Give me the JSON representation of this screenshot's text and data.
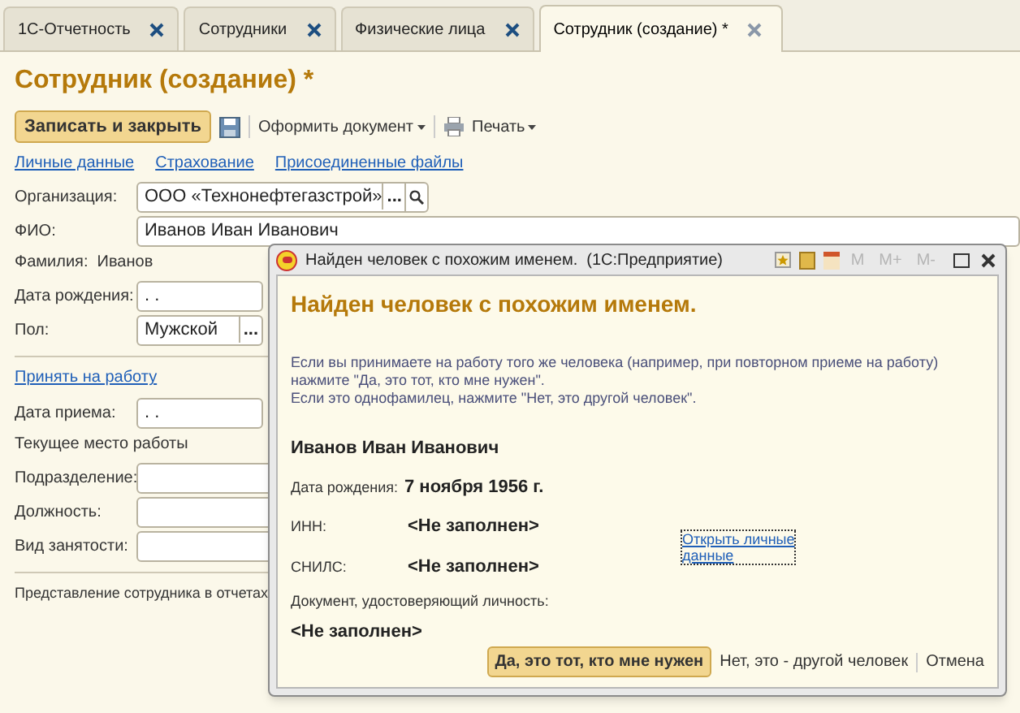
{
  "tabs": [
    {
      "label": "1С-Отчетность",
      "selected": false
    },
    {
      "label": "Сотрудники",
      "selected": false
    },
    {
      "label": "Физические лица",
      "selected": false
    },
    {
      "label": "Сотрудник (создание) *",
      "selected": true
    }
  ],
  "form": {
    "title": "Сотрудник (создание) *",
    "toolbar": {
      "save_close": "Записать и закрыть",
      "create_document": "Оформить документ",
      "print": "Печать"
    },
    "links": [
      "Личные данные",
      "Страхование",
      "Присоединенные файлы"
    ],
    "organization": {
      "label": "Организация:",
      "value": "ООО «Технонефтегазстрой»",
      "button": "..."
    },
    "fio": {
      "label": "ФИО:",
      "value": "Иванов Иван Иванович"
    },
    "surname": "Фамилия:  Иванов",
    "birth_date": {
      "label": "Дата рождения:",
      "value": " .  ."
    },
    "gender": {
      "label": "Пол:",
      "value": "Мужской",
      "button": "..."
    },
    "hire_link": "Принять на работу",
    "hire_date": {
      "label": "Дата приема:",
      "value": " .  ."
    },
    "current_work": "Текущее место работы",
    "work_fields": [
      {
        "label": "Подразделение:"
      },
      {
        "label": "Должность:"
      },
      {
        "label": "Вид занятости:"
      }
    ],
    "report_name": "Представление сотрудника в отчетах"
  },
  "dialog": {
    "title": "Найден человек с похожим именем.  (1С:Предприятие)",
    "toolbar": [
      "M",
      "M+",
      "M-"
    ],
    "heading": "Найден человек с похожим именем.",
    "message": [
      "Если вы принимаете на работу того же человека (например, при повторном приеме на работу)",
      "нажмите \"Да, это тот, кто мне нужен\".",
      "Если это однофамилец, нажмите \"Нет, это другой человек\"."
    ],
    "person": "Иванов Иван Иванович",
    "birth": {
      "label": "Дата рождения:",
      "value": "7 ноября 1956 г."
    },
    "inn": {
      "label": "ИНН:",
      "value": "<Не заполнен>"
    },
    "snils": {
      "label": "СНИЛС:",
      "value": "<Не заполнен>"
    },
    "open_link": [
      "Открыть личные",
      "данные"
    ],
    "doc": {
      "label": "Документ, удостоверяющий личность:",
      "value": "<Не заполнен>"
    },
    "buttons": [
      "Да, это тот, кто мне нужен",
      "Нет, это - другой человек",
      "Отмена"
    ]
  }
}
